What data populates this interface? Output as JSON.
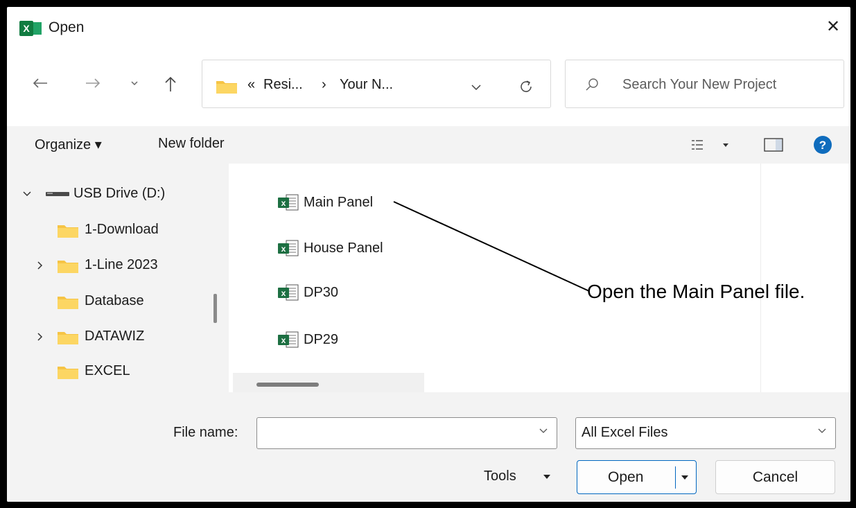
{
  "window": {
    "title": "Open",
    "close_glyph": "✕"
  },
  "nav": {
    "breadcrumb": [
      "«",
      "Resi...",
      "›",
      "Your N..."
    ],
    "search_placeholder": "Search Your New Project"
  },
  "toolbar": {
    "organize_label": "Organize ▾",
    "new_folder_label": "New folder"
  },
  "tree": {
    "items": [
      {
        "label": "USB Drive (D:)",
        "icon": "drive-icon",
        "chevron": "expanded"
      },
      {
        "label": "1-Download",
        "icon": "folder-icon",
        "chevron": "none"
      },
      {
        "label": "1-Line 2023",
        "icon": "folder-icon",
        "chevron": "collapsed"
      },
      {
        "label": "Database",
        "icon": "folder-icon",
        "chevron": "none"
      },
      {
        "label": "DATAWIZ",
        "icon": "folder-icon",
        "chevron": "collapsed"
      },
      {
        "label": "EXCEL",
        "icon": "folder-icon",
        "chevron": "none"
      }
    ]
  },
  "files": [
    {
      "name": "Main Panel",
      "icon": "excel-file-icon"
    },
    {
      "name": "House Panel",
      "icon": "excel-file-icon"
    },
    {
      "name": "DP30",
      "icon": "excel-file-icon"
    },
    {
      "name": "DP29",
      "icon": "excel-file-icon"
    }
  ],
  "bottom": {
    "file_name_label": "File name:",
    "file_name_value": "",
    "file_type_value": "All Excel Files",
    "tools_label": "Tools",
    "open_label": "Open",
    "cancel_label": "Cancel"
  },
  "annotation": {
    "text": "Open the Main Panel file."
  },
  "colors": {
    "excel_green": "#1d6f42",
    "folder_yellow": "#f6c445",
    "help_blue": "#0f6cbd",
    "accent": "#0067c0"
  }
}
